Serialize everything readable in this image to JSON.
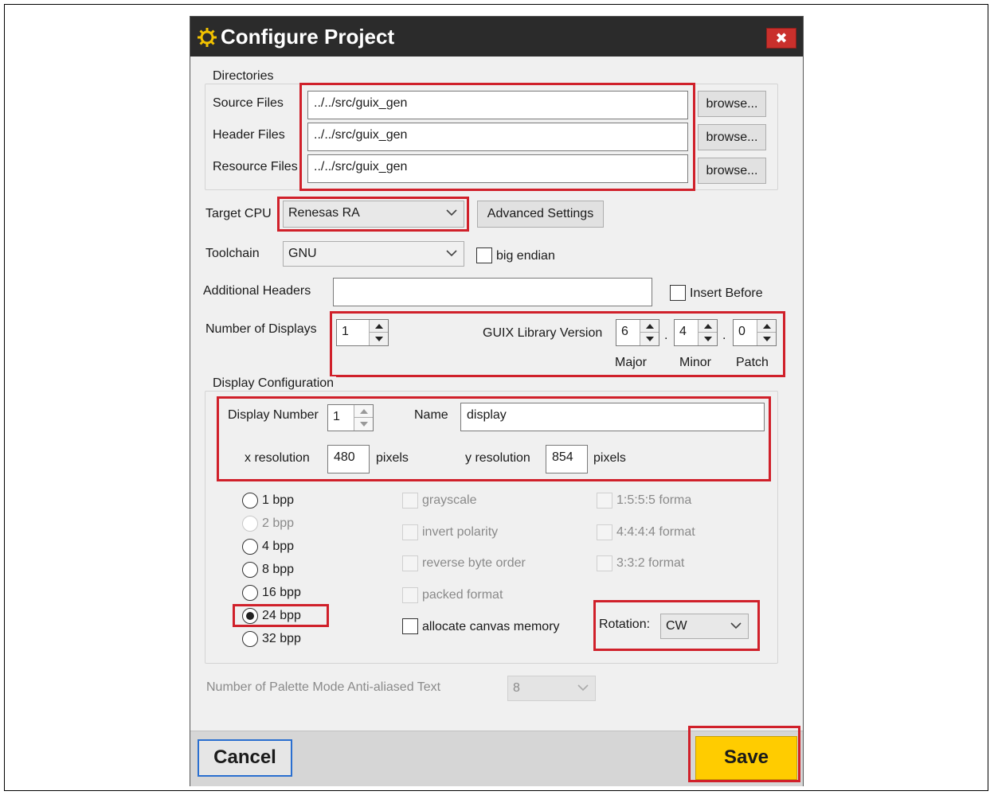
{
  "dialog": {
    "title": "Configure Project",
    "close_glyph": "✖"
  },
  "directories": {
    "group_label": "Directories",
    "source_label": "Source Files",
    "source_value": "../../src/guix_gen",
    "header_label": "Header Files",
    "header_value": "../../src/guix_gen",
    "resource_label": "Resource Files",
    "resource_value": "../../src/guix_gen",
    "browse_label": "browse..."
  },
  "target_cpu": {
    "label": "Target CPU",
    "value": "Renesas RA",
    "advanced_label": "Advanced Settings"
  },
  "toolchain": {
    "label": "Toolchain",
    "value": "GNU",
    "big_endian_label": "big endian"
  },
  "additional_headers": {
    "label": "Additional Headers",
    "value": "",
    "insert_before_label": "Insert Before"
  },
  "displays": {
    "label": "Number of Displays",
    "value": "1"
  },
  "guix_version": {
    "label": "GUIX Library Version",
    "major": "6",
    "minor": "4",
    "patch": "0",
    "dot": ".",
    "major_label": "Major",
    "minor_label": "Minor",
    "patch_label": "Patch"
  },
  "display_config": {
    "group_label": "Display Configuration",
    "display_number_label": "Display Number",
    "display_number": "1",
    "name_label": "Name",
    "name_value": "display",
    "x_res_label": "x resolution",
    "x_res": "480",
    "y_res_label": "y resolution",
    "y_res": "854",
    "pixels_label": "pixels"
  },
  "bpp_options": [
    {
      "label": "1 bpp",
      "checked": false,
      "disabled": false
    },
    {
      "label": "2 bpp",
      "checked": false,
      "disabled": true
    },
    {
      "label": "4 bpp",
      "checked": false,
      "disabled": false
    },
    {
      "label": "8 bpp",
      "checked": false,
      "disabled": false
    },
    {
      "label": "16 bpp",
      "checked": false,
      "disabled": false
    },
    {
      "label": "24 bpp",
      "checked": true,
      "disabled": false
    },
    {
      "label": "32 bpp",
      "checked": false,
      "disabled": false
    }
  ],
  "format_options": {
    "grayscale": "grayscale",
    "invert_polarity": "invert polarity",
    "reverse_byte_order": "reverse byte order",
    "packed_format": "packed format",
    "allocate_canvas": "allocate canvas memory",
    "f1555": "1:5:5:5 forma",
    "f4444": "4:4:4:4 format",
    "f332": "3:3:2 format"
  },
  "rotation": {
    "label": "Rotation:",
    "value": "CW"
  },
  "palette": {
    "label": "Number of Palette Mode Anti-aliased Text",
    "value": "8"
  },
  "footer": {
    "cancel_label": "Cancel",
    "save_label": "Save"
  },
  "colors": {
    "highlight_red": "#d0202a",
    "save_yellow": "#ffcc00",
    "titlebar": "#2b2b2b"
  }
}
